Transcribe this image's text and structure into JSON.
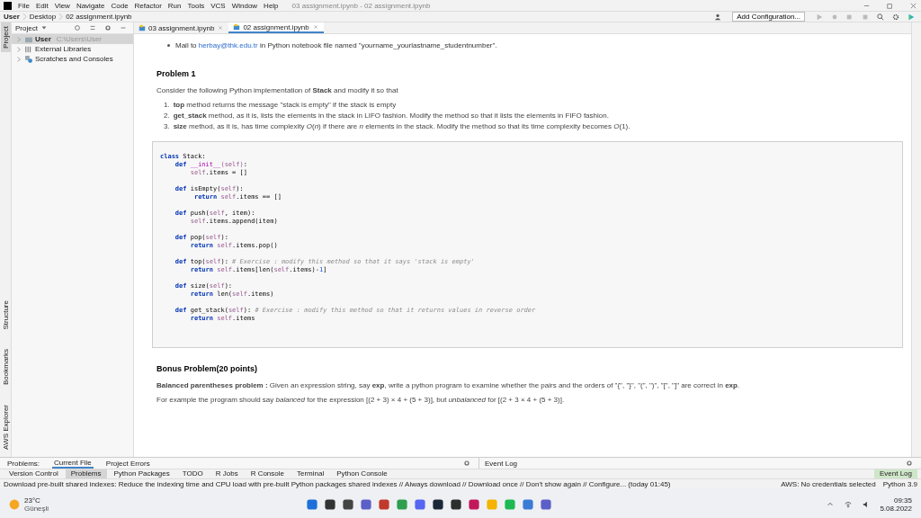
{
  "menu_bar": {
    "items": [
      "File",
      "Edit",
      "View",
      "Navigate",
      "Code",
      "Refactor",
      "Run",
      "Tools",
      "VCS",
      "Window",
      "Help"
    ],
    "title": "03 assignment.ipynb - 02 assignment.ipynb"
  },
  "breadcrumbs": [
    "User",
    "Desktop",
    "02 assignment.ipynb"
  ],
  "toolbar": {
    "run_config": "Add Configuration..."
  },
  "side_tabs": {
    "top": [
      {
        "label": "Project",
        "selected": true
      }
    ],
    "bottom": [
      {
        "label": "Structure",
        "selected": false
      },
      {
        "label": "Bookmarks",
        "selected": false
      },
      {
        "label": "AWS Explorer",
        "selected": false
      }
    ]
  },
  "project_panel": {
    "title": "Project",
    "items": [
      {
        "label": "User",
        "path": "C:\\Users\\User",
        "kind": "folder",
        "selected": true
      },
      {
        "label": "External Libraries",
        "kind": "library",
        "selected": false
      },
      {
        "label": "Scratches and Consoles",
        "kind": "scratch",
        "selected": false
      }
    ]
  },
  "editor_tabs": [
    {
      "label": "03 assignment.ipynb",
      "selected": false
    },
    {
      "label": "02 assignment.ipynb",
      "selected": true
    }
  ],
  "notebook": {
    "mail_line": {
      "before": "Mail to ",
      "link": "herbay@thk.edu.tr",
      "after": " in Python notebook file named \"yourname_yourlastname_studentnumber\"."
    },
    "problem_title": "Problem 1",
    "intro": "Consider the following Python implementation of **Stack** and modify it so that",
    "tasks": [
      {
        "marker": "1.",
        "text": "**top** method returns the message \"stack is empty\" if the stack is empty"
      },
      {
        "marker": "2.",
        "text": "**get_stack** method, as it is, lists the elements in the stack in LIFO fashion. Modify the method so that it lists the elements in FIFO fashion."
      },
      {
        "marker": "3.",
        "text": "**size** method, as it is, has time complexity *O*(*n*) if there are *n* elements in the stack. Modify the method so that its time complexity becomes *O*(1)."
      }
    ],
    "code": [
      [
        [
          {
            "kind": "keyword",
            "text": "class"
          },
          {
            "kind": "plain",
            "text": " Stack:"
          }
        ],
        [
          {
            "kind": "keyword",
            "text": "    def "
          },
          {
            "kind": "magic",
            "text": "__init__"
          },
          {
            "kind": "self",
            "text": "(self)"
          },
          {
            "kind": "plain",
            "text": ":"
          }
        ],
        [
          {
            "kind": "self",
            "text": "        self"
          },
          {
            "kind": "plain",
            "text": ".items = []"
          }
        ]
      ],
      [
        [
          {
            "kind": "keyword",
            "text": "    def "
          },
          {
            "kind": "plain",
            "text": "isEmpty("
          },
          {
            "kind": "self",
            "text": "self"
          },
          {
            "kind": "plain",
            "text": "):"
          }
        ],
        [
          {
            "kind": "keyword",
            "text": "         return "
          },
          {
            "kind": "self",
            "text": "self"
          },
          {
            "kind": "plain",
            "text": ".items == []"
          }
        ]
      ],
      [
        [
          {
            "kind": "keyword",
            "text": "    def "
          },
          {
            "kind": "plain",
            "text": "push("
          },
          {
            "kind": "self",
            "text": "self"
          },
          {
            "kind": "plain",
            "text": ", item):"
          }
        ],
        [
          {
            "kind": "self",
            "text": "        self"
          },
          {
            "kind": "plain",
            "text": ".items.append(item)"
          }
        ]
      ],
      [
        [
          {
            "kind": "keyword",
            "text": "    def "
          },
          {
            "kind": "plain",
            "text": "pop("
          },
          {
            "kind": "self",
            "text": "self"
          },
          {
            "kind": "plain",
            "text": "):"
          }
        ],
        [
          {
            "kind": "keyword",
            "text": "        return "
          },
          {
            "kind": "self",
            "text": "self"
          },
          {
            "kind": "plain",
            "text": ".items.pop()"
          }
        ]
      ],
      [
        [
          {
            "kind": "keyword",
            "text": "    def "
          },
          {
            "kind": "plain",
            "text": "top("
          },
          {
            "kind": "self",
            "text": "self"
          },
          {
            "kind": "plain",
            "text": "): "
          },
          {
            "kind": "comment",
            "text": "# Exercise : modify this method so that it says 'stack is empty'"
          }
        ],
        [
          {
            "kind": "keyword",
            "text": "        return "
          },
          {
            "kind": "self",
            "text": "self"
          },
          {
            "kind": "plain",
            "text": ".items[len("
          },
          {
            "kind": "self",
            "text": "self"
          },
          {
            "kind": "plain",
            "text": ".items)-"
          },
          {
            "kind": "number",
            "text": "1"
          },
          {
            "kind": "plain",
            "text": "]"
          }
        ]
      ],
      [
        [
          {
            "kind": "keyword",
            "text": "    def "
          },
          {
            "kind": "plain",
            "text": "size("
          },
          {
            "kind": "self",
            "text": "self"
          },
          {
            "kind": "plain",
            "text": "):"
          }
        ],
        [
          {
            "kind": "keyword",
            "text": "        return "
          },
          {
            "kind": "plain",
            "text": "len("
          },
          {
            "kind": "self",
            "text": "self"
          },
          {
            "kind": "plain",
            "text": ".items)"
          }
        ]
      ],
      [
        [
          {
            "kind": "keyword",
            "text": "    def "
          },
          {
            "kind": "plain",
            "text": "get_stack("
          },
          {
            "kind": "self",
            "text": "self"
          },
          {
            "kind": "plain",
            "text": "): "
          },
          {
            "kind": "comment",
            "text": "# Exercise : modify this method so that it returns values in reverse order"
          }
        ],
        [
          {
            "kind": "keyword",
            "text": "        return "
          },
          {
            "kind": "self",
            "text": "self"
          },
          {
            "kind": "plain",
            "text": ".items"
          }
        ]
      ]
    ],
    "bonus_title": "Bonus Problem(20 points)",
    "bonus_text": "**Balanced parentheses problem :** Given an expression string, say **exp**, write a python program to examine whether the pairs and the orders of \"{\", \"}\", \"(\", \")\", \"[\", \"]\" are correct in **exp**.",
    "example": "For example the program should say *balanced* for the expression [(2 + 3) × 4 + (5 + 3)], but *unbalanced* for [(2 + 3 × 4 + (5 + 3)]."
  },
  "problems_panel": {
    "tabs": [
      {
        "label": "Problems:",
        "selected": false
      },
      {
        "label": "Current File",
        "selected": true
      },
      {
        "label": "Project Errors",
        "selected": false
      }
    ],
    "event_log_title": "Event Log"
  },
  "tool_tabs": [
    {
      "label": "Version Control",
      "selected": false
    },
    {
      "label": "Problems",
      "selected": true
    },
    {
      "label": "Python Packages",
      "selected": false
    },
    {
      "label": "TODO",
      "selected": false
    },
    {
      "label": "R Jobs",
      "selected": false
    },
    {
      "label": "R Console",
      "selected": false
    },
    {
      "label": "Terminal",
      "selected": false
    },
    {
      "label": "Python Console",
      "selected": false
    }
  ],
  "event_log_tab": {
    "label": "Event Log",
    "selected": true
  },
  "status_bar": {
    "message": "Download pre-built shared indexes: Reduce the indexing time and CPU load with pre-built Python packages shared indexes // Always download // Download once // Don't show again // Configure... (today 01:45)",
    "aws": "AWS: No credentials selected",
    "interpreter": "Python 3.9"
  },
  "taskbar": {
    "temperature": "23°C",
    "weather": "Güneşli",
    "time": "09:35",
    "date": "5.08.2022"
  }
}
